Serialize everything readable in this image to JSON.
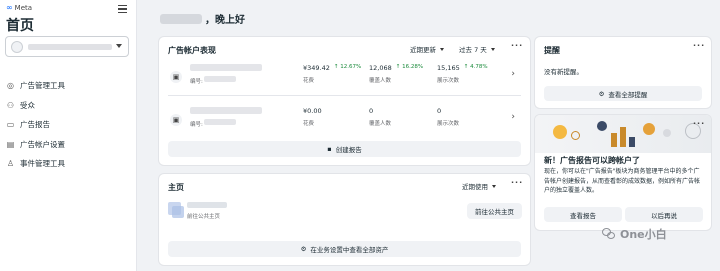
{
  "sidebar": {
    "brand": "Meta",
    "title": "首页",
    "nav": [
      {
        "label": "广告管理工具",
        "icon": "target-icon"
      },
      {
        "label": "受众",
        "icon": "audience-icon"
      },
      {
        "label": "广告报告",
        "icon": "report-icon"
      },
      {
        "label": "广告帐户设置",
        "icon": "settings-icon"
      },
      {
        "label": "事件管理工具",
        "icon": "events-icon"
      }
    ]
  },
  "greeting": {
    "suffix": "，晚上好"
  },
  "performance": {
    "title": "广告帐户表现",
    "sort_label": "近期更新",
    "range_label": "过去 7 天",
    "accounts": [
      {
        "id_label": "编号:",
        "spend": "¥349.42",
        "spend_change": "↑ 12.67%",
        "spend_label": "花费",
        "reach": "12,068",
        "reach_change": "↑ 16.28%",
        "reach_label": "覆盖人数",
        "impressions": "15,165",
        "impressions_change": "↑ 4.78%",
        "impressions_label": "展示次数"
      },
      {
        "id_label": "编号:",
        "spend": "¥0.00",
        "spend_change": "",
        "spend_label": "花费",
        "reach": "0",
        "reach_change": "",
        "reach_label": "覆盖人数",
        "impressions": "0",
        "impressions_change": "",
        "impressions_label": "展示次数"
      }
    ],
    "create_report": "创建报告"
  },
  "home": {
    "title": "主页",
    "sort_label": "近期使用",
    "page_sub": "前往公共主页",
    "goto_button": "前往公共主页",
    "view_all": "在业务设置中查看全部资产"
  },
  "alerts": {
    "title": "提醒",
    "empty": "没有新提醒。",
    "view_all": "查看全部提醒"
  },
  "promo": {
    "title": "新！广告报告可以跨帐户了",
    "body": "现在，你可以在\"广告报告\"板块为商务管理平台中的多个广告帐户创建报告，从而查看彰的成效数据，例如所有广告帐户的独立覆盖人数。",
    "primary": "查看报告",
    "secondary": "以后再说"
  },
  "watermark": "One小白"
}
